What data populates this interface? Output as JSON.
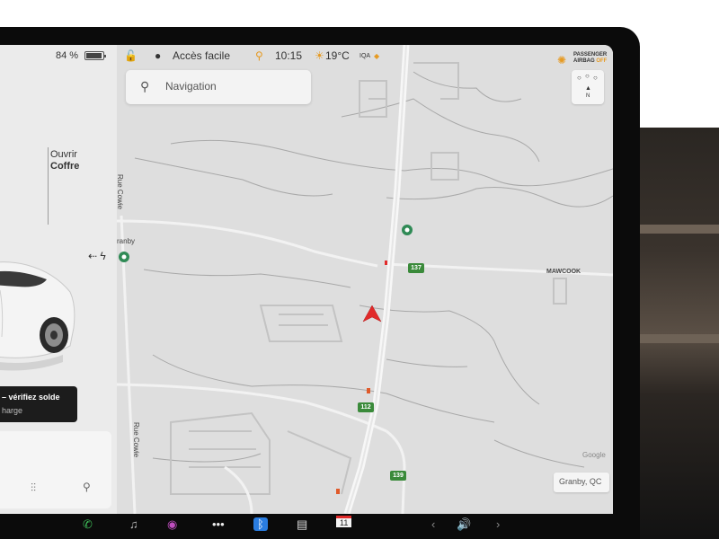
{
  "status": {
    "battery_pct": "84 %",
    "profile": "Accès facile",
    "time": "10:15",
    "temperature": "19°C",
    "aqi_label": "IQA"
  },
  "airbag": {
    "line1": "PASSENGER",
    "line2": "AIRBAG",
    "state": "OFF"
  },
  "search": {
    "placeholder": "Navigation"
  },
  "car_panel": {
    "trunk_action": "Ouvrir",
    "trunk_name": "Coffre",
    "charge_alert_line1": "– vérifiez solde",
    "charge_alert_line2": "harge"
  },
  "map": {
    "labels": {
      "town": "ranby",
      "road_left": "Rue Cowie",
      "road_left_lower": "Rue Cowie",
      "area_east": "MAWCOOK"
    },
    "shields": {
      "route_137": "137",
      "route_112": "112",
      "route_139": "139"
    },
    "location": "Granby, QC",
    "attribution": "Google"
  },
  "compass": {
    "north": "N"
  },
  "dock": {
    "icons": [
      "phone-icon",
      "music-icon",
      "camera-icon",
      "more-icon",
      "bluetooth-icon",
      "notes-icon",
      "calendar-icon",
      "chevron-left-icon",
      "volume-icon",
      "chevron-right-icon"
    ],
    "calendar_day": "11"
  },
  "colors": {
    "accent_red": "#e12a2a",
    "route_green": "#3a8a3a",
    "airbag_orange": "#e69a22"
  }
}
